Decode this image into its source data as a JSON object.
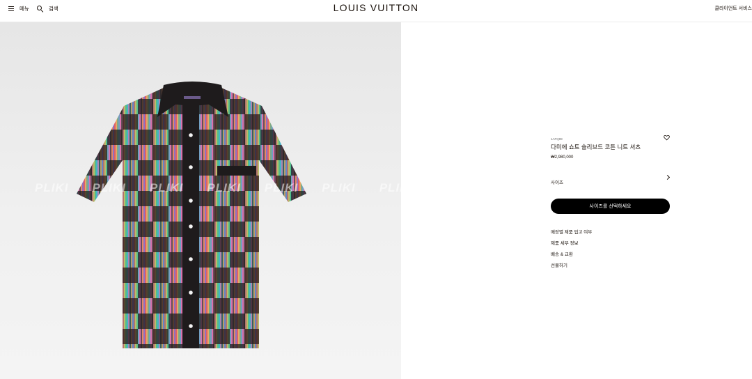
{
  "header": {
    "menu_label": "메뉴",
    "search_label": "검색",
    "logo": "LOUIS VUITTON",
    "client_service": "클라이언트 서비스"
  },
  "image": {
    "watermark": [
      "PLIKI",
      "PLIKI",
      "PLIKI",
      "PLIKI",
      "PLIKI",
      "PLIKI",
      "PLIKI"
    ]
  },
  "product": {
    "sku": "1AFQ89",
    "name": "다미에 쇼트 슬리브드 코튼 니트 셔츠",
    "price": "₩2,980,000",
    "size_label": "사이즈",
    "select_size_button": "사이즈를 선택하세요",
    "links": [
      "매장별 제품 입고 여부",
      "제품 세부 정보",
      "배송 & 교환",
      "선물하기"
    ]
  },
  "colors": {
    "accent": "#000000",
    "text": "#19110b",
    "background": "#ffffff"
  },
  "icons": [
    "hamburger-icon",
    "search-icon",
    "heart-icon",
    "chevron-right-icon"
  ]
}
